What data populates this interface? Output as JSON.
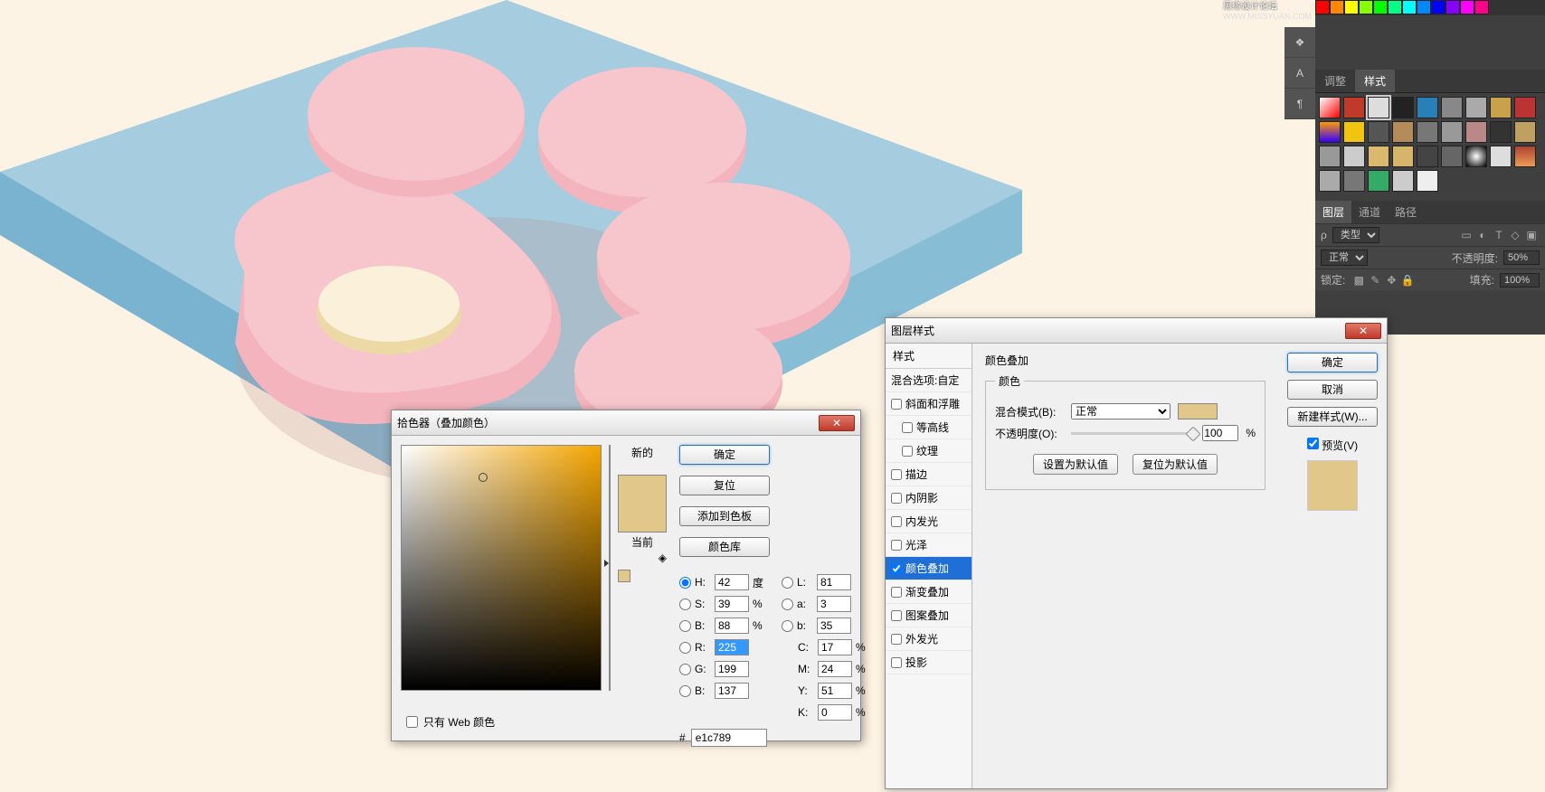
{
  "logo": {
    "title": "思缘设计论坛",
    "domain": "WWW.MISSYUAN.COM"
  },
  "right_panel": {
    "tab_adjust": "调整",
    "tab_styles": "样式",
    "tab_layers": "图层",
    "tab_channels": "通道",
    "tab_paths": "路径",
    "kind_label": "类型",
    "blend_mode": "正常",
    "opacity_label": "不透明度:",
    "opacity_value": "50%",
    "lock_label": "锁定:",
    "fill_label": "填充:",
    "fill_value": "100%"
  },
  "picker": {
    "title": "拾色器（叠加颜色）",
    "new_label": "新的",
    "current_label": "当前",
    "btn_ok": "确定",
    "btn_reset": "复位",
    "btn_add": "添加到色板",
    "btn_lib": "颜色库",
    "hsb": {
      "h_label": "H:",
      "h": "42",
      "h_unit": "度",
      "s_label": "S:",
      "s": "39",
      "s_unit": "%",
      "b_label": "B:",
      "b": "88",
      "b_unit": "%"
    },
    "rgb": {
      "r_label": "R:",
      "r": "225",
      "g_label": "G:",
      "g": "199",
      "b_label": "B:",
      "b": "137"
    },
    "lab": {
      "l_label": "L:",
      "l": "81",
      "a_label": "a:",
      "a": "3",
      "b_label": "b:",
      "b": "35"
    },
    "cmyk": {
      "c_label": "C:",
      "c": "17",
      "m_label": "M:",
      "m": "24",
      "y_label": "Y:",
      "y": "51",
      "k_label": "K:",
      "k": "0",
      "unit": "%"
    },
    "hex_label": "#",
    "hex": "e1c789",
    "web_only": "只有 Web 颜色"
  },
  "layer_style": {
    "title": "图层样式",
    "left": {
      "header": "样式",
      "blend_opts": "混合选项:自定",
      "bevel": "斜面和浮雕",
      "contour": "等高线",
      "texture": "纹理",
      "stroke": "描边",
      "inner_shadow": "内阴影",
      "inner_glow": "内发光",
      "satin": "光泽",
      "color_overlay": "颜色叠加",
      "gradient_overlay": "渐变叠加",
      "pattern_overlay": "图案叠加",
      "outer_glow": "外发光",
      "drop_shadow": "投影"
    },
    "mid": {
      "section_title": "颜色叠加",
      "group_label": "颜色",
      "blend_label": "混合模式(B):",
      "blend_value": "正常",
      "opacity_label": "不透明度(O):",
      "opacity_value": "100",
      "opacity_unit": "%",
      "btn_default": "设置为默认值",
      "btn_reset": "复位为默认值"
    },
    "right": {
      "ok": "确定",
      "cancel": "取消",
      "new_style": "新建样式(W)...",
      "preview": "预览(V)"
    }
  }
}
